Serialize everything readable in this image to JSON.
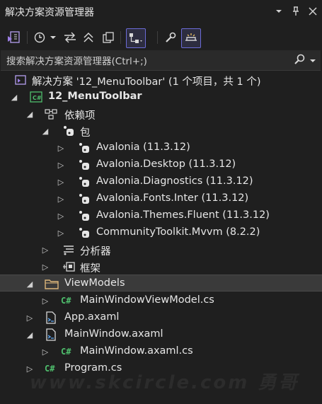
{
  "panel": {
    "title": "解决方案资源管理器"
  },
  "search": {
    "placeholder": "搜索解决方案资源管理器(Ctrl+;)"
  },
  "tree": {
    "solution": "解决方案 '12_MenuToolbar' (1 个项目，共 1 个)",
    "project": "12_MenuToolbar",
    "dependencies": "依赖项",
    "packages": "包",
    "package_items": [
      "Avalonia (11.3.12)",
      "Avalonia.Desktop (11.3.12)",
      "Avalonia.Diagnostics (11.3.12)",
      "Avalonia.Fonts.Inter (11.3.12)",
      "Avalonia.Themes.Fluent (11.3.12)",
      "CommunityToolkit.Mvvm (8.2.2)"
    ],
    "analyzers": "分析器",
    "frameworks": "框架",
    "viewmodels_folder": "ViewModels",
    "mainwindow_viewmodel": "MainWindowViewModel.cs",
    "app_axaml": "App.axaml",
    "mainwindow_axaml": "MainWindow.axaml",
    "mainwindow_axaml_cs": "MainWindow.axaml.cs",
    "program_cs": "Program.cs"
  },
  "cs_badge": "C#",
  "watermark": "www.skcircle.com 勇哥",
  "colors": {
    "background": "#1f1f1f",
    "accent": "#6b6bd6",
    "csharp_green": "#4fbf6d",
    "folder_yellow": "#dcb67a",
    "selected_row": "#3a3a3a"
  }
}
